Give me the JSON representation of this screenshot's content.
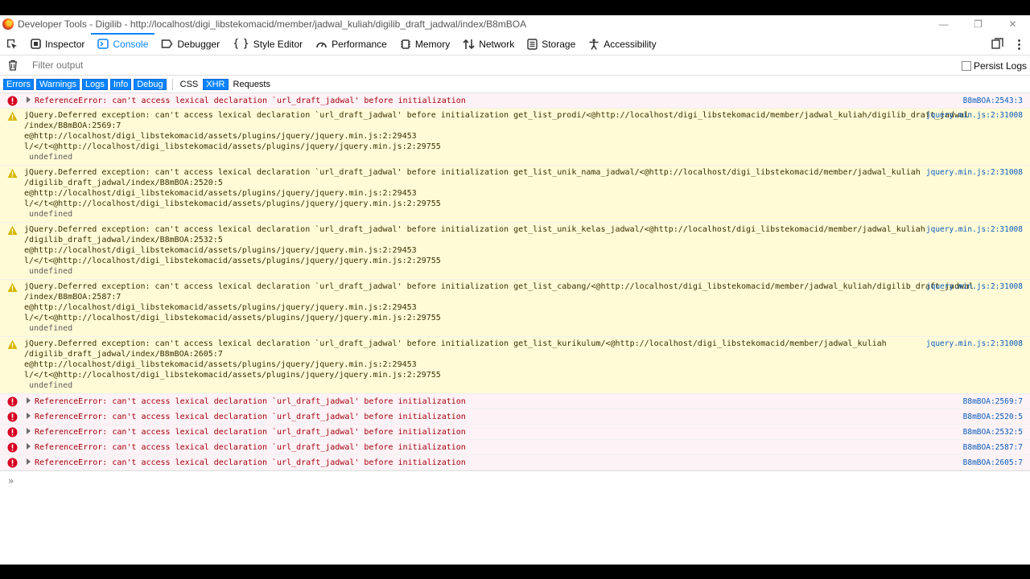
{
  "window": {
    "title": "Developer Tools - Digilib - http://localhost/digi_libstekomacid/member/jadwal_kuliah/digilib_draft_jadwal/index/B8mBOA",
    "minimize": "—",
    "restore": "❐",
    "close": "✕"
  },
  "toolbar": {
    "tabs": [
      {
        "label": "Inspector",
        "icon": "inspector-icon"
      },
      {
        "label": "Console",
        "icon": "console-icon"
      },
      {
        "label": "Debugger",
        "icon": "debugger-icon"
      },
      {
        "label": "Style Editor",
        "icon": "style-editor-icon"
      },
      {
        "label": "Performance",
        "icon": "performance-icon"
      },
      {
        "label": "Memory",
        "icon": "memory-icon"
      },
      {
        "label": "Network",
        "icon": "network-icon"
      },
      {
        "label": "Storage",
        "icon": "storage-icon"
      },
      {
        "label": "Accessibility",
        "icon": "accessibility-icon"
      }
    ],
    "selected": "Console",
    "more": "⋮"
  },
  "filter": {
    "placeholder": "Filter output",
    "persist_label": "Persist Logs"
  },
  "levels": {
    "errors": "Errors",
    "warnings": "Warnings",
    "logs": "Logs",
    "info": "Info",
    "debug": "Debug",
    "css": "CSS",
    "xhr": "XHR",
    "requests": "Requests"
  },
  "colors": {
    "accent": "#0a84ff",
    "error_bg": "#fdf2f5",
    "error_text": "#a4000f",
    "warning_bg": "#fffbd6",
    "warning_text": "#3a3000",
    "link": "#0b5cbd"
  },
  "messages": [
    {
      "type": "error",
      "text": "ReferenceError: can't access lexical declaration `url_draft_jadwal' before initialization",
      "source": "B8mBOA:2543:3"
    },
    {
      "type": "warning",
      "lines": [
        "jQuery.Deferred exception: can't access lexical declaration `url_draft_jadwal' before initialization get_list_prodi/<@http://localhost/digi_libstekomacid/member/jadwal_kuliah/digilib_draft_jadwal",
        "/index/B8mBOA:2569:7",
        "e@http://localhost/digi_libstekomacid/assets/plugins/jquery/jquery.min.js:2:29453",
        "l/</t<@http://localhost/digi_libstekomacid/assets/plugins/jquery/jquery.min.js:2:29755"
      ],
      "extra": "undefined",
      "source": "jquery.min.js:2:31008"
    },
    {
      "type": "warning",
      "lines": [
        "jQuery.Deferred exception: can't access lexical declaration `url_draft_jadwal' before initialization get_list_unik_nama_jadwal/<@http://localhost/digi_libstekomacid/member/jadwal_kuliah",
        "/digilib_draft_jadwal/index/B8mBOA:2520:5",
        "e@http://localhost/digi_libstekomacid/assets/plugins/jquery/jquery.min.js:2:29453",
        "l/</t<@http://localhost/digi_libstekomacid/assets/plugins/jquery/jquery.min.js:2:29755"
      ],
      "extra": "undefined",
      "source": "jquery.min.js:2:31008"
    },
    {
      "type": "warning",
      "lines": [
        "jQuery.Deferred exception: can't access lexical declaration `url_draft_jadwal' before initialization get_list_unik_kelas_jadwal/<@http://localhost/digi_libstekomacid/member/jadwal_kuliah",
        "/digilib_draft_jadwal/index/B8mBOA:2532:5",
        "e@http://localhost/digi_libstekomacid/assets/plugins/jquery/jquery.min.js:2:29453",
        "l/</t<@http://localhost/digi_libstekomacid/assets/plugins/jquery/jquery.min.js:2:29755"
      ],
      "extra": "undefined",
      "source": "jquery.min.js:2:31008"
    },
    {
      "type": "warning",
      "lines": [
        "jQuery.Deferred exception: can't access lexical declaration `url_draft_jadwal' before initialization get_list_cabang/<@http://localhost/digi_libstekomacid/member/jadwal_kuliah/digilib_draft_jadwal",
        "/index/B8mBOA:2587:7",
        "e@http://localhost/digi_libstekomacid/assets/plugins/jquery/jquery.min.js:2:29453",
        "l/</t<@http://localhost/digi_libstekomacid/assets/plugins/jquery/jquery.min.js:2:29755"
      ],
      "extra": "undefined",
      "source": "jquery.min.js:2:31008"
    },
    {
      "type": "warning",
      "lines": [
        "jQuery.Deferred exception: can't access lexical declaration `url_draft_jadwal' before initialization get_list_kurikulum/<@http://localhost/digi_libstekomacid/member/jadwal_kuliah",
        "/digilib_draft_jadwal/index/B8mBOA:2605:7",
        "e@http://localhost/digi_libstekomacid/assets/plugins/jquery/jquery.min.js:2:29453",
        "l/</t<@http://localhost/digi_libstekomacid/assets/plugins/jquery/jquery.min.js:2:29755"
      ],
      "extra": "undefined",
      "source": "jquery.min.js:2:31008"
    },
    {
      "type": "error",
      "text": "ReferenceError: can't access lexical declaration `url_draft_jadwal' before initialization",
      "source": "B8mBOA:2569:7"
    },
    {
      "type": "error",
      "text": "ReferenceError: can't access lexical declaration `url_draft_jadwal' before initialization",
      "source": "B8mBOA:2520:5"
    },
    {
      "type": "error",
      "text": "ReferenceError: can't access lexical declaration `url_draft_jadwal' before initialization",
      "source": "B8mBOA:2532:5"
    },
    {
      "type": "error",
      "text": "ReferenceError: can't access lexical declaration `url_draft_jadwal' before initialization",
      "source": "B8mBOA:2587:7"
    },
    {
      "type": "error",
      "text": "ReferenceError: can't access lexical declaration `url_draft_jadwal' before initialization",
      "source": "B8mBOA:2605:7"
    }
  ],
  "console_input": {
    "prompt": "»"
  }
}
